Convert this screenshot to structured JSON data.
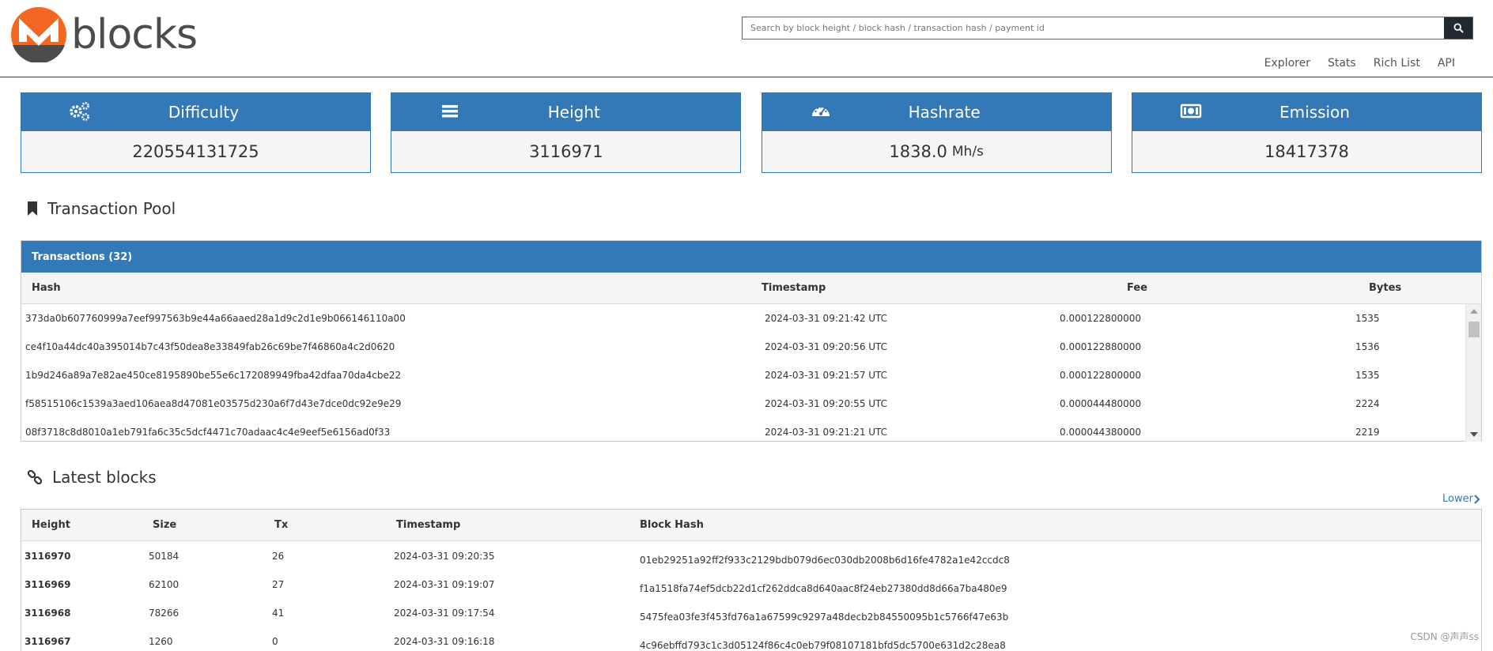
{
  "logo": {
    "text": "blocks"
  },
  "search": {
    "placeholder": "Search by block height / block hash / transaction hash / payment id"
  },
  "nav": [
    "Explorer",
    "Stats",
    "Rich List",
    "API"
  ],
  "stats": [
    {
      "title": "Difficulty",
      "value": "220554131725",
      "unit": "",
      "icon": "gears-icon"
    },
    {
      "title": "Height",
      "value": "3116971",
      "unit": "",
      "icon": "bars-icon"
    },
    {
      "title": "Hashrate",
      "value": "1838.0",
      "unit": "Mh/s",
      "icon": "gauge-icon"
    },
    {
      "title": "Emission",
      "value": "18417378",
      "unit": "",
      "icon": "money-icon"
    }
  ],
  "pool": {
    "section_title": "Transaction Pool",
    "bar_label": "Transactions (32)",
    "columns": [
      "Hash",
      "Timestamp",
      "Fee",
      "Bytes"
    ],
    "rows": [
      {
        "hash": "373da0b607760999a7eef997563b9e44a66aaed28a1d9c2d1e9b066146110a00",
        "timestamp": "2024-03-31 09:21:42 UTC",
        "fee": "0.000122800000",
        "bytes": "1535"
      },
      {
        "hash": "ce4f10a44dc40a395014b7c43f50dea8e33849fab26c69be7f46860a4c2d0620",
        "timestamp": "2024-03-31 09:20:56 UTC",
        "fee": "0.000122880000",
        "bytes": "1536"
      },
      {
        "hash": "1b9d246a89a7e82ae450ce8195890be55e6c172089949fba42dfaa70da4cbe22",
        "timestamp": "2024-03-31 09:21:57 UTC",
        "fee": "0.000122800000",
        "bytes": "1535"
      },
      {
        "hash": "f58515106c1539a3aed106aea8d47081e03575d230a6f7d43e7dce0dc92e9e29",
        "timestamp": "2024-03-31 09:20:55 UTC",
        "fee": "0.000044480000",
        "bytes": "2224"
      },
      {
        "hash": "08f3718c8d8010a1eb791fa6c35c5dcf4471c70adaac4c4e9eef5e6156ad0f33",
        "timestamp": "2024-03-31 09:21:21 UTC",
        "fee": "0.000044380000",
        "bytes": "2219"
      }
    ]
  },
  "blocks": {
    "section_title": "Latest blocks",
    "lower_link": "Lower",
    "columns": [
      "Height",
      "Size",
      "Tx",
      "Timestamp",
      "Block Hash"
    ],
    "rows": [
      {
        "height": "3116970",
        "size": "50184",
        "tx": "26",
        "timestamp": "2024-03-31 09:20:35",
        "hash": "01eb29251a92ff2f933c2129bdb079d6ec030db2008b6d16fe4782a1e42ccdc8"
      },
      {
        "height": "3116969",
        "size": "62100",
        "tx": "27",
        "timestamp": "2024-03-31 09:19:07",
        "hash": "f1a1518fa74ef5dcb22d1cf262ddca8d640aac8f24eb27380dd8d66a7ba480e9"
      },
      {
        "height": "3116968",
        "size": "78266",
        "tx": "41",
        "timestamp": "2024-03-31 09:17:54",
        "hash": "5475fea03fe3f453fd76a1a67599c9297a48decb2b84550095b1c5766f47e63b"
      },
      {
        "height": "3116967",
        "size": "1260",
        "tx": "0",
        "timestamp": "2024-03-31 09:16:18",
        "hash": "4c96ebffd793c1c3d05124f86c4c0eb79f08107181bfd5dc5700e631d2c28ea8"
      }
    ]
  },
  "watermark": "CSDN @声声ss",
  "colors": {
    "accent": "#3479b7",
    "logo_orange": "#f26822",
    "logo_gray": "#4c4c4c"
  }
}
